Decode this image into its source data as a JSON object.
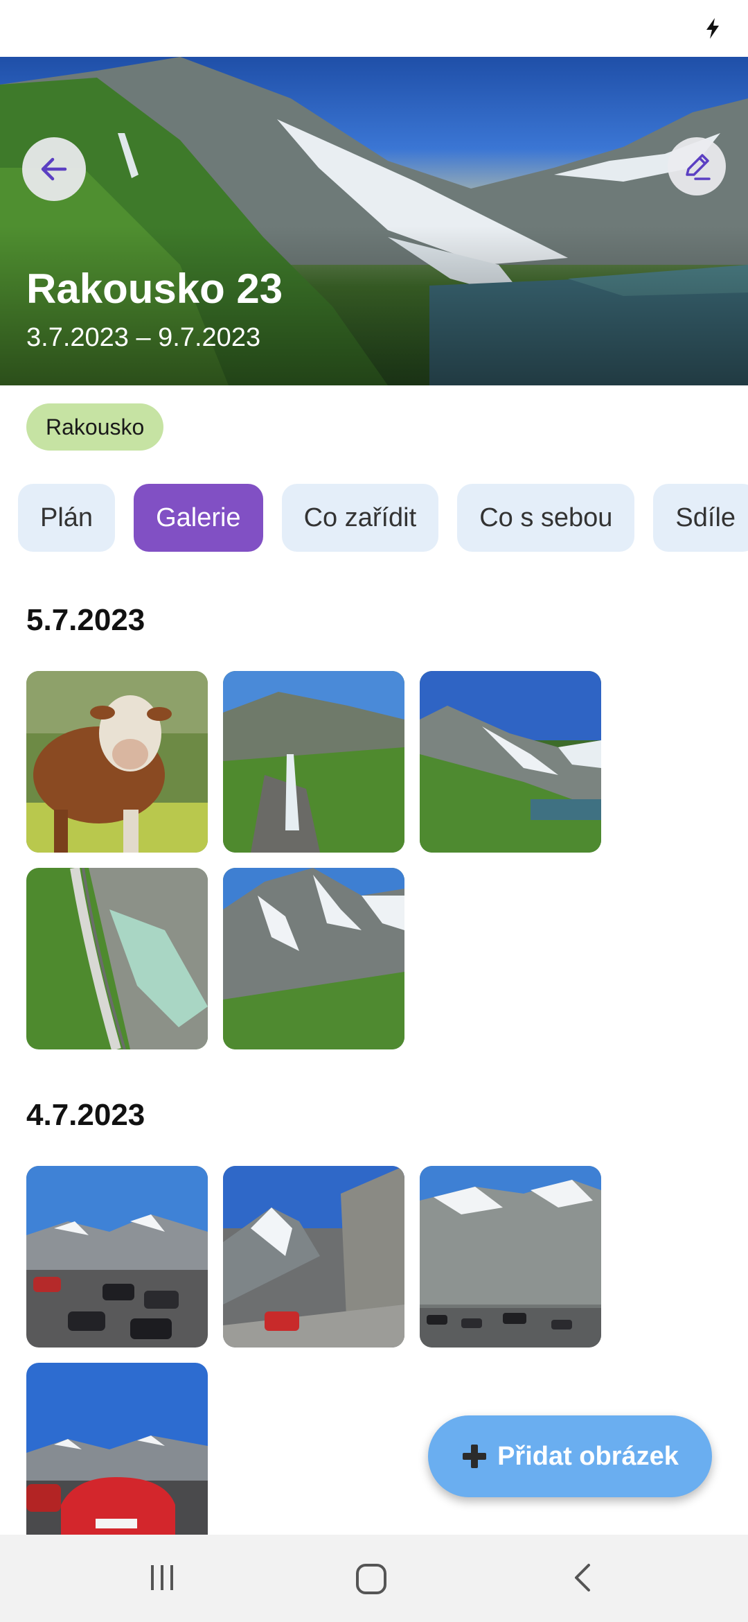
{
  "header": {
    "title": "Rakousko 23",
    "dates": "3.7.2023 – 9.7.2023",
    "back_icon": "arrow-left-icon",
    "edit_icon": "pencil-icon"
  },
  "tag": {
    "label": "Rakousko"
  },
  "tabs": [
    {
      "label": "Plán",
      "active": false
    },
    {
      "label": "Galerie",
      "active": true
    },
    {
      "label": "Co zařídit",
      "active": false
    },
    {
      "label": "Co s sebou",
      "active": false
    },
    {
      "label": "Sdíle",
      "active": false
    }
  ],
  "gallery": [
    {
      "date": "5.7.2023",
      "photo_count": 5
    },
    {
      "date": "4.7.2023",
      "photo_count": 4
    }
  ],
  "fab": {
    "label": "Přidat obrázek",
    "icon": "plus-icon"
  },
  "colors": {
    "accent": "#8150c4",
    "tab_bg": "#e4eef9",
    "tag_bg": "#c6e3a3",
    "fab_bg": "#6aaef0"
  }
}
